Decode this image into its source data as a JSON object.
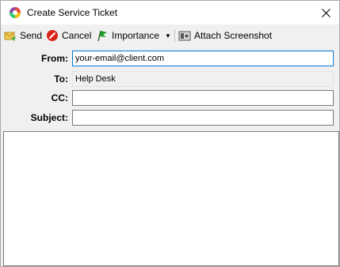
{
  "window": {
    "title": "Create Service Ticket"
  },
  "toolbar": {
    "send_label": "Send",
    "cancel_label": "Cancel",
    "importance_label": "Importance",
    "attach_label": "Attach Screenshot"
  },
  "fields": {
    "from_label": "From:",
    "from_value": "your-email@client.com",
    "to_label": "To:",
    "to_value": "Help Desk",
    "cc_label": "CC:",
    "cc_value": "",
    "subject_label": "Subject:",
    "subject_value": ""
  },
  "body": {
    "value": ""
  },
  "colors": {
    "focus_border": "#0078d7",
    "cancel_red": "#d9241c",
    "importance_green": "#1f9a2c",
    "send_yellow": "#f2c94c"
  }
}
